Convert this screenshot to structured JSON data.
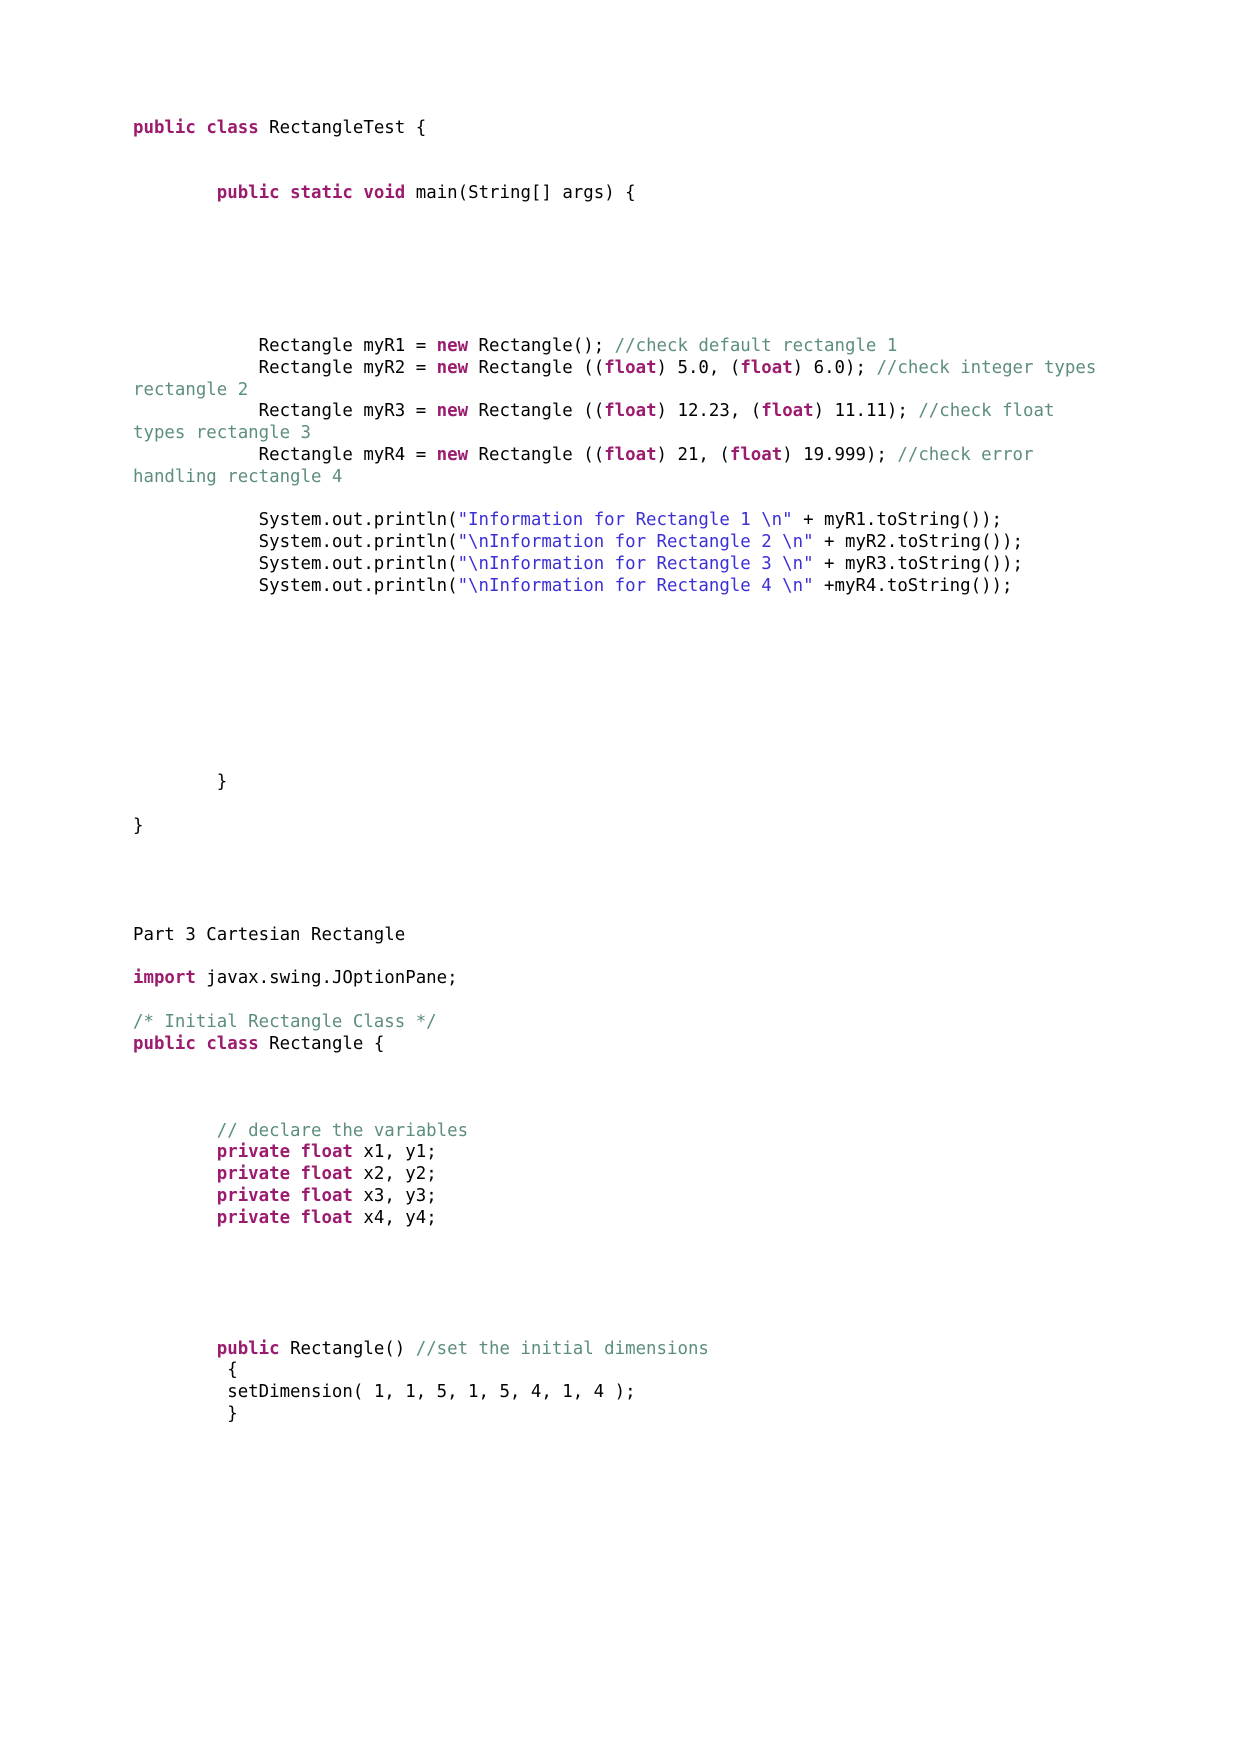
{
  "document": {
    "page_background": "#ffffff",
    "syntax_colors": {
      "keyword": "#9b1b6e",
      "comment": "#5d8e7b",
      "string": "#3b2fd6",
      "plain": "#000000"
    },
    "blocks": {
      "class_decl_line": {
        "kw_public": "public",
        "kw_class": "class",
        "rest": " RectangleTest {"
      },
      "main_method_line": {
        "indent": "        ",
        "kw_public": "public",
        "kw_static": "static",
        "kw_void": "void",
        "rest": " main(String[] args) {"
      },
      "rect1_line": {
        "indent": "            ",
        "pre": "Rectangle myR1 = ",
        "kw_new": "new",
        "mid": " Rectangle(); ",
        "comment": "//check default rectangle 1"
      },
      "rect2_line": {
        "indent": "            ",
        "pre": "Rectangle myR2 = ",
        "kw_new": "new",
        "mid": " Rectangle ((",
        "kw_float_1": "float",
        "mid2": ") 5.0, (",
        "kw_float_2": "float",
        "mid3": ") 6.0); ",
        "comment": "//check integer types rectangle 2"
      },
      "rect3_line": {
        "indent": "            ",
        "pre": "Rectangle myR3 = ",
        "kw_new": "new",
        "mid": " Rectangle ((",
        "kw_float_1": "float",
        "mid2": ") 12.23, (",
        "kw_float_2": "float",
        "mid3": ") 11.11); ",
        "comment": "//check float types rectangle 3"
      },
      "rect4_line": {
        "indent": "            ",
        "pre": "Rectangle myR4 = ",
        "kw_new": "new",
        "mid": " Rectangle ((",
        "kw_float_1": "float",
        "mid2": ") 21, (",
        "kw_float_2": "float",
        "mid3": ") 19.999); ",
        "comment": "//check error handling rectangle 4"
      },
      "println1": {
        "indent": "            ",
        "pre": "System.out.println(",
        "string": "\"Information for Rectangle 1 \\n\"",
        "post": " + myR1.toString());"
      },
      "println2": {
        "indent": "            ",
        "pre": "System.out.println(",
        "string": "\"\\nInformation for Rectangle 2 \\n\"",
        "post": " + myR2.toString());"
      },
      "println3": {
        "indent": "            ",
        "pre": "System.out.println(",
        "string": "\"\\nInformation for Rectangle 3 \\n\"",
        "post": " + myR3.toString());"
      },
      "println4": {
        "indent": "            ",
        "pre": "System.out.println(",
        "string": "\"\\nInformation for Rectangle 4 \\n\"",
        "post": " +myR4.toString());"
      },
      "close_method": "        }",
      "close_class": "}",
      "part3_heading": "Part 3 Cartesian Rectangle",
      "import_line": {
        "kw_import": "import",
        "rest": " javax.swing.JOptionPane;"
      },
      "initial_class_comment": "/* Initial Rectangle Class */",
      "rectangle_class_decl": {
        "kw_public": "public",
        "kw_class": "class",
        "rest": " Rectangle {"
      },
      "declare_vars_comment": {
        "indent": "        ",
        "comment": "// declare the variables"
      },
      "field_x1": {
        "indent": "        ",
        "kw_private": "private",
        "kw_float": "float",
        "rest": " x1, y1;"
      },
      "field_x2": {
        "indent": "        ",
        "kw_private": "private",
        "kw_float": "float",
        "rest": " x2, y2;"
      },
      "field_x3": {
        "indent": "        ",
        "kw_private": "private",
        "kw_float": "float",
        "rest": " x3, y3;"
      },
      "field_x4": {
        "indent": "        ",
        "kw_private": "private",
        "kw_float": "float",
        "rest": " x4, y4;"
      },
      "constructor_line": {
        "indent": "        ",
        "kw_public": "public",
        "mid": " Rectangle() ",
        "comment": "//set the initial dimensions"
      },
      "constructor_open_brace": "         {",
      "set_dimension_call": "         setDimension( 1, 1, 5, 1, 5, 4, 1, 4 );",
      "constructor_close_brace": "         }"
    }
  }
}
